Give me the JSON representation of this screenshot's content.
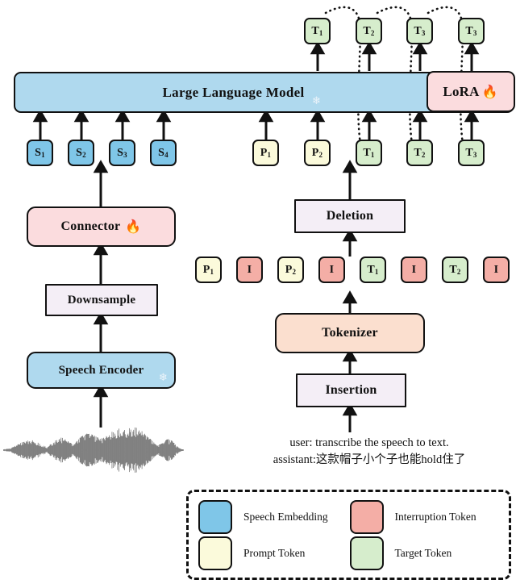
{
  "diagram": {
    "title": "Speech LLM training architecture with insertion/deletion token pipeline",
    "colors": {
      "speech_embedding": "#7FC6E8",
      "prompt_token": "#FBFADB",
      "target_token": "#D6EDCC",
      "interruption_token": "#F4AEA6",
      "llm_bar": "#AFD9EE",
      "lora": "#FBDCDE",
      "connector": "#FBDCDE",
      "tokenizer": "#FBDFCF",
      "lavender_block": "#F4EEF6",
      "waveform": "#808080",
      "outline": "#111111"
    }
  },
  "blocks": {
    "llm": {
      "label": "Large Language Model",
      "frozen_icon": "snowflake-icon"
    },
    "lora": {
      "label": "LoRA",
      "trainable_icon": "fire-icon"
    },
    "connector": {
      "label": "Connector",
      "trainable_icon": "fire-icon"
    },
    "downsample": {
      "label": "Downsample"
    },
    "speech_encoder": {
      "label": "Speech Encoder",
      "frozen_icon": "snowflake-icon"
    },
    "deletion": {
      "label": "Deletion"
    },
    "tokenizer": {
      "label": "Tokenizer"
    },
    "insertion": {
      "label": "Insertion"
    }
  },
  "output_tokens": [
    {
      "label": "T",
      "sub": "1",
      "kind": "target"
    },
    {
      "label": "T",
      "sub": "2",
      "kind": "target"
    },
    {
      "label": "T",
      "sub": "3",
      "kind": "target"
    },
    {
      "label": "T",
      "sub": "3",
      "kind": "target"
    }
  ],
  "input_tokens": [
    {
      "label": "S",
      "sub": "1",
      "kind": "speech"
    },
    {
      "label": "S",
      "sub": "2",
      "kind": "speech"
    },
    {
      "label": "S",
      "sub": "3",
      "kind": "speech"
    },
    {
      "label": "S",
      "sub": "4",
      "kind": "speech"
    },
    {
      "label": "P",
      "sub": "1",
      "kind": "prompt"
    },
    {
      "label": "P",
      "sub": "2",
      "kind": "prompt"
    },
    {
      "label": "T",
      "sub": "1",
      "kind": "target"
    },
    {
      "label": "T",
      "sub": "2",
      "kind": "target"
    },
    {
      "label": "T",
      "sub": "3",
      "kind": "target"
    }
  ],
  "tokenizer_output_tokens": [
    {
      "label": "P",
      "sub": "1",
      "kind": "prompt"
    },
    {
      "label": "I",
      "sub": "",
      "kind": "interrupt"
    },
    {
      "label": "P",
      "sub": "2",
      "kind": "prompt"
    },
    {
      "label": "I",
      "sub": "",
      "kind": "interrupt"
    },
    {
      "label": "T",
      "sub": "1",
      "kind": "target"
    },
    {
      "label": "I",
      "sub": "",
      "kind": "interrupt"
    },
    {
      "label": "T",
      "sub": "2",
      "kind": "target"
    },
    {
      "label": "I",
      "sub": "",
      "kind": "interrupt"
    }
  ],
  "dialogue": {
    "line1": "user: transcribe the speech to text.",
    "line2": "assistant:这款帽子小个子也能hold住了"
  },
  "legend": {
    "items": [
      {
        "label": "Speech Embedding",
        "color": "#7FC6E8",
        "swatch_name": "legend-swatch-speech-embedding"
      },
      {
        "label": "Interruption Token",
        "color": "#F4AEA6",
        "swatch_name": "legend-swatch-interruption-token"
      },
      {
        "label": "Prompt Token",
        "color": "#FBFADB",
        "swatch_name": "legend-swatch-prompt-token"
      },
      {
        "label": "Target Token",
        "color": "#D6EDCC",
        "swatch_name": "legend-swatch-target-token"
      }
    ]
  },
  "icons": {
    "fire": "🔥",
    "snowflake": "❄"
  }
}
